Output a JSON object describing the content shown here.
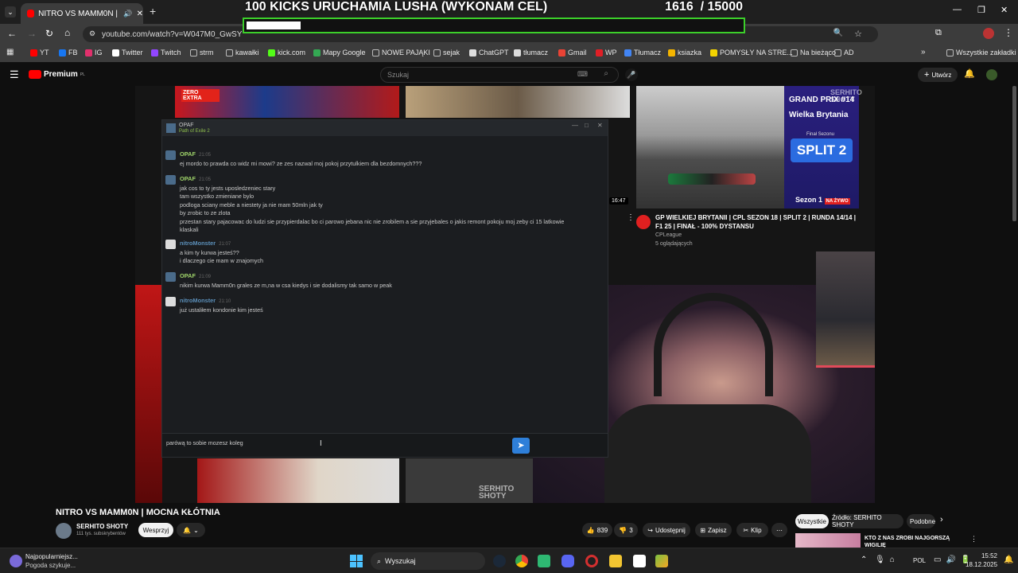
{
  "browser": {
    "tab_title": "NITRO VS MAMM0N | MOCN",
    "url": "youtube.com/watch?v=W047M0_GwSY",
    "bookmarks": [
      {
        "label": "YT",
        "icon": "youtube-icon",
        "color": "#ff0000"
      },
      {
        "label": "FB",
        "icon": "facebook-icon",
        "color": "#1877f2"
      },
      {
        "label": "IG",
        "icon": "instagram-icon",
        "color": "#e1306c"
      },
      {
        "label": "Twitter",
        "icon": "x-icon",
        "color": "#ffffff"
      },
      {
        "label": "Twitch",
        "icon": "twitch-icon",
        "color": "#9146ff"
      },
      {
        "label": "strm",
        "icon": "folder-icon",
        "color": "#bbbbbb"
      },
      {
        "label": "kawałki",
        "icon": "folder-icon",
        "color": "#bbbbbb"
      },
      {
        "label": "kick.com",
        "icon": "kick-icon",
        "color": "#53fc18"
      },
      {
        "label": "Mapy Google",
        "icon": "maps-icon",
        "color": "#34a853"
      },
      {
        "label": "NOWE PAJĄKI",
        "icon": "folder-icon",
        "color": "#bbbbbb"
      },
      {
        "label": "sejak",
        "icon": "folder-icon",
        "color": "#bbbbbb"
      },
      {
        "label": "ChatGPT",
        "icon": "chatgpt-icon",
        "color": "#dddddd"
      },
      {
        "label": "tłumacz",
        "icon": "chatgpt-icon",
        "color": "#dddddd"
      },
      {
        "label": "Gmail",
        "icon": "gmail-icon",
        "color": "#ea4335"
      },
      {
        "label": "WP",
        "icon": "wp-icon",
        "color": "#e01f26"
      },
      {
        "label": "Tłumacz",
        "icon": "translate-icon",
        "color": "#4285f4"
      },
      {
        "label": "ksiazka",
        "icon": "book-icon",
        "color": "#f4b400"
      },
      {
        "label": "POMYSŁY NA STRE...",
        "icon": "note-icon",
        "color": "#f4d400"
      },
      {
        "label": "Na bieżąco",
        "icon": "folder-icon",
        "color": "#bbbbbb"
      },
      {
        "label": "AD",
        "icon": "folder-icon",
        "color": "#bbbbbb"
      }
    ],
    "all_bookmarks": "Wszystkie zakładki"
  },
  "goal": {
    "title": "100 KICKS URUCHAMIA LUSHA (WYKONAM CEL)",
    "current": "1616",
    "target": "/ 15000",
    "progress": 0.108,
    "bar_color": "#3ccf2a"
  },
  "youtube": {
    "premium_label": "Premium",
    "premium_suffix": "PL",
    "search_placeholder": "Szukaj",
    "create_label": "Utwórz"
  },
  "stream_overlay": {
    "grand_prix": "GRAND PRIX #14",
    "location": "Wielka Brytania",
    "final_label": "Finał Sezonu",
    "split": "SPLIT 2",
    "season": "Sezon 1",
    "live": "NA ŻYWO",
    "duration": "16:47",
    "zero_label": "ZERO EXTRA",
    "watermark_top": "SERHITO SHOTY",
    "watermark_bottom": "SERHITO SHOTY",
    "rec_title": "GP WIELKIEJ BRYTANII | CPL SEZON 18 | SPLIT 2 | RUNDA 14/14 | F1 25 | FINAŁ - 100% DYSTANSU",
    "rec_channel": "CPLeague",
    "rec_viewers": "5 oglądających"
  },
  "chat": {
    "header_name": "OPAF",
    "header_game": "Path of Exile 2",
    "messages": [
      {
        "name": "OPAF",
        "time": "21:05",
        "lines": [
          "ej mordo to prawda co widz mi mowi? ze zes nazwal moj pokoj przytulkiem dla bezdomnych???"
        ],
        "own": true
      },
      {
        "name": "OPAF",
        "time": "21:05",
        "lines": [
          "jak cos to ty jests uposledzeniec stary",
          "tam wszystko zmieniane bylo",
          "podloga sciany meble a niestety ja nie mam 50mln jak ty",
          "by zrobic to ze zlota",
          "przestan stary pajacowac do ludzi sie przypierdalac bo ci parowo jebana nic nie zrobilem a sie przyjebales o jakis remont pokoju moj zeby ci 15 latkowie",
          "klaskali"
        ],
        "own": true
      },
      {
        "name": "nitroMonster",
        "time": "21:07",
        "lines": [
          "a kim ty kurwa jesteś??",
          "i dlaczego cie mam w znajomych"
        ],
        "own": false
      },
      {
        "name": "OPAF",
        "time": "21:09",
        "lines": [
          "nikim kurwa Mamm0n grales ze m,na w csa kiedys i sie dodalismy tak samo w peak"
        ],
        "own": true
      },
      {
        "name": "nitroMonster",
        "time": "21:10",
        "lines": [
          "już ustaliłem kondonie kim jesteś"
        ],
        "own": false
      }
    ],
    "input_value": "parówą to sobie mozesz koleg",
    "send_icon": "send-icon"
  },
  "video_info": {
    "title": "NITRO VS MAMM0N | MOCNA KŁÓTNIA",
    "channel": "SERHITO SHOTY",
    "subscribers": "111 tys. subskrybentów",
    "support_label": "Wesprzyj",
    "likes": "839",
    "dislikes": "3",
    "share": "Udostępnij",
    "save": "Zapisz",
    "clip": "Klip",
    "chips": [
      "Wszystkie",
      "Źródło: SERHITO SHOTY",
      "Podobne"
    ],
    "side_next_title": "KTO Z NAS ZROBI NAJGORSZĄ WIGILIĘ"
  },
  "taskbar": {
    "weather_title": "Najpopularniejsz...",
    "weather_sub": "Pogoda szykuje...",
    "search_label": "Wyszukaj",
    "language": "POL",
    "time": "15:52",
    "date": "18.12.2025"
  }
}
